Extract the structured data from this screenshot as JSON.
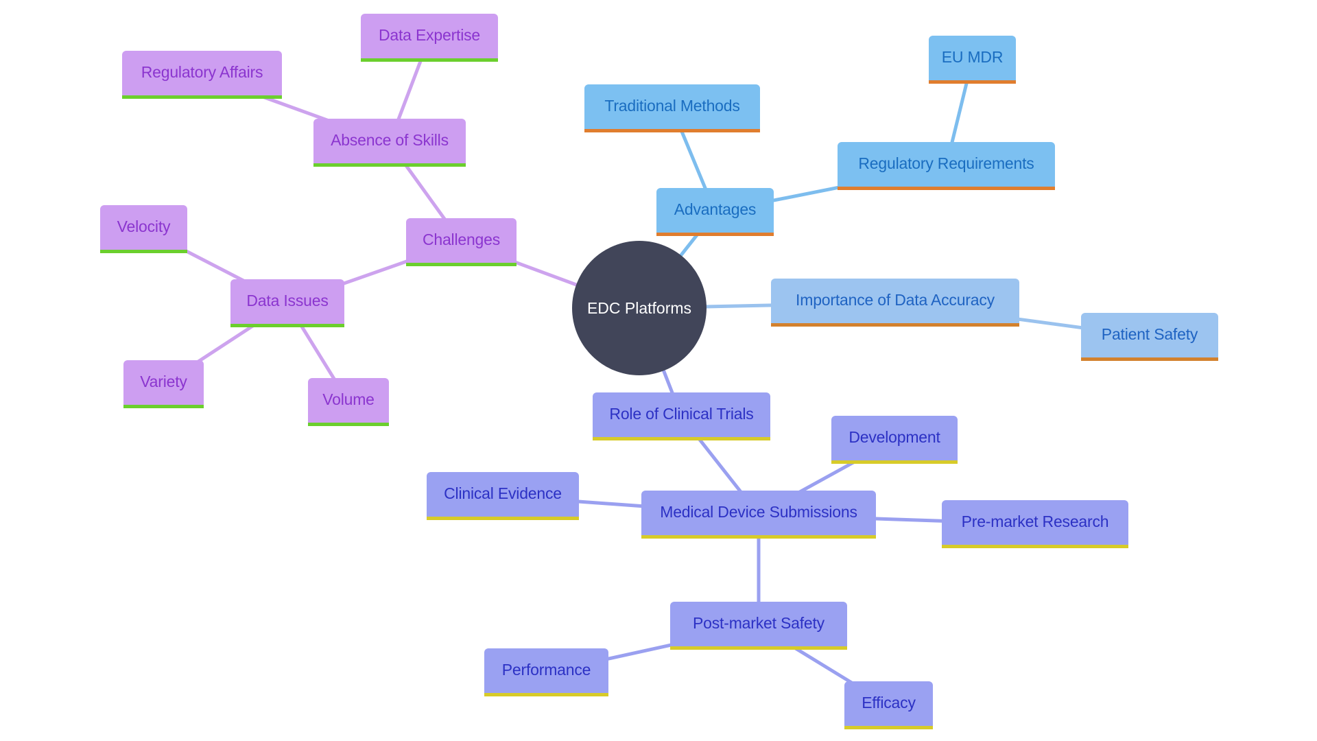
{
  "diagram": {
    "type": "mindmap",
    "root": {
      "id": "edc",
      "label": "EDC Platforms"
    },
    "colors": {
      "root_fill": "#414559",
      "root_text": "#ffffff",
      "challenges_fill": "#cd9ef1",
      "challenges_text": "#8b35cf",
      "challenges_accent": "#6bcf2d",
      "challenges_edge": "#cda3ee",
      "advantages_fill": "#7cc0f1",
      "advantages_text": "#1a6dc0",
      "advantages_accent": "#e07d2e",
      "advantages_edge": "#7dbdee",
      "accuracy_fill": "#9cc4f0",
      "accuracy_text": "#1f63c2",
      "accuracy_accent": "#d3812d",
      "accuracy_edge": "#9ac2ee",
      "trials_fill": "#9aa1f2",
      "trials_text": "#2c31c4",
      "trials_accent": "#d7cb29",
      "trials_edge": "#9aa0f0"
    },
    "nodes": [
      {
        "id": "challenges",
        "label": "Challenges",
        "parent": "edc",
        "branch": "purple"
      },
      {
        "id": "absence_skills",
        "label": "Absence of Skills",
        "parent": "challenges",
        "branch": "purple"
      },
      {
        "id": "data_expertise",
        "label": "Data Expertise",
        "parent": "absence_skills",
        "branch": "purple"
      },
      {
        "id": "regulatory_affairs",
        "label": "Regulatory Affairs",
        "parent": "absence_skills",
        "branch": "purple"
      },
      {
        "id": "data_issues",
        "label": "Data Issues",
        "parent": "challenges",
        "branch": "purple"
      },
      {
        "id": "velocity",
        "label": "Velocity",
        "parent": "data_issues",
        "branch": "purple"
      },
      {
        "id": "variety",
        "label": "Variety",
        "parent": "data_issues",
        "branch": "purple"
      },
      {
        "id": "volume",
        "label": "Volume",
        "parent": "data_issues",
        "branch": "purple"
      },
      {
        "id": "advantages",
        "label": "Advantages",
        "parent": "edc",
        "branch": "blue"
      },
      {
        "id": "traditional_methods",
        "label": "Traditional Methods",
        "parent": "advantages",
        "branch": "blue"
      },
      {
        "id": "regulatory_requirements",
        "label": "Regulatory Requirements",
        "parent": "advantages",
        "branch": "blue"
      },
      {
        "id": "eu_mdr",
        "label": "EU MDR",
        "parent": "regulatory_requirements",
        "branch": "blue"
      },
      {
        "id": "data_accuracy",
        "label": "Importance of Data Accuracy",
        "parent": "edc",
        "branch": "lightblue"
      },
      {
        "id": "patient_safety",
        "label": "Patient Safety",
        "parent": "data_accuracy",
        "branch": "lightblue"
      },
      {
        "id": "clinical_trials",
        "label": "Role of Clinical Trials",
        "parent": "edc",
        "branch": "indigo"
      },
      {
        "id": "device_submissions",
        "label": "Medical Device Submissions",
        "parent": "clinical_trials",
        "branch": "indigo"
      },
      {
        "id": "development",
        "label": "Development",
        "parent": "device_submissions",
        "branch": "indigo"
      },
      {
        "id": "clinical_evidence",
        "label": "Clinical Evidence",
        "parent": "device_submissions",
        "branch": "indigo"
      },
      {
        "id": "premarket_research",
        "label": "Pre-market Research",
        "parent": "device_submissions",
        "branch": "indigo"
      },
      {
        "id": "postmarket_safety",
        "label": "Post-market Safety",
        "parent": "device_submissions",
        "branch": "indigo"
      },
      {
        "id": "performance",
        "label": "Performance",
        "parent": "postmarket_safety",
        "branch": "indigo"
      },
      {
        "id": "efficacy",
        "label": "Efficacy",
        "parent": "postmarket_safety",
        "branch": "indigo"
      }
    ]
  }
}
